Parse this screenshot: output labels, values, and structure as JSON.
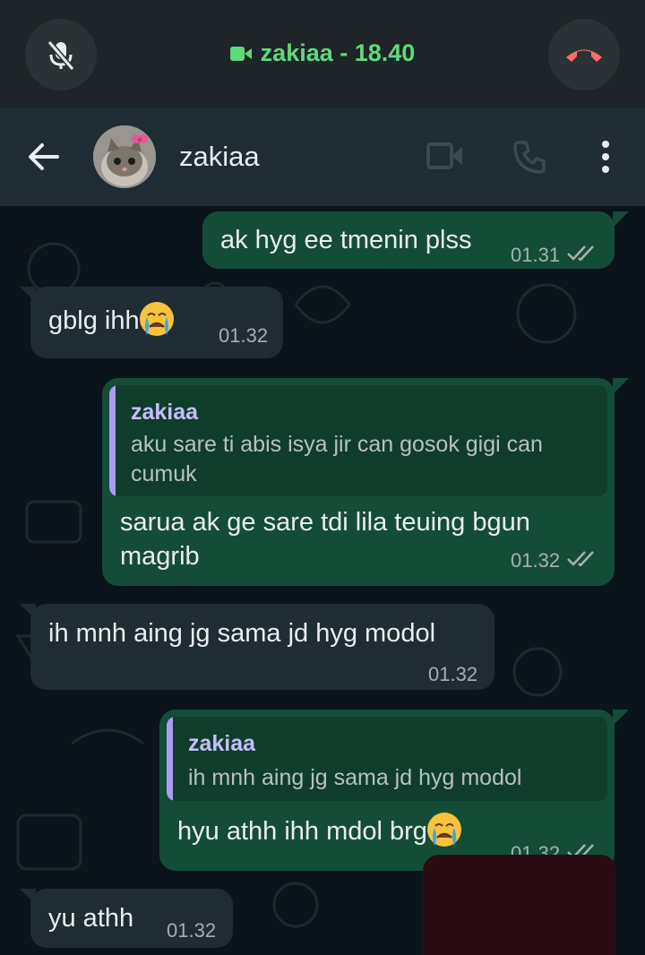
{
  "call_bar": {
    "title": "zakiaa - 18.40"
  },
  "header": {
    "contact_name": "zakiaa"
  },
  "colors": {
    "call_accent": "#5fd97a",
    "end_call": "#ff6b6b",
    "outgoing_bubble": "#144d37",
    "incoming_bubble": "#202c33",
    "quote_bar": "#a99cf2"
  },
  "icons": [
    "mic-off-icon",
    "video-icon",
    "end-call-icon",
    "back-arrow-icon",
    "video-call-icon",
    "voice-call-icon",
    "more-options-icon",
    "read-receipt-icon",
    "crying-emoji-icon"
  ],
  "messages": [
    {
      "direction": "outgoing",
      "text": "ak hyg ee tmenin plss",
      "time": "01.31",
      "status": "read"
    },
    {
      "direction": "incoming",
      "text": "gblg ihh",
      "emoji": "crying-face",
      "time": "01.32"
    },
    {
      "direction": "outgoing",
      "quote": {
        "name": "zakiaa",
        "text": "aku sare ti abis isya jir can gosok gigi can cumuk"
      },
      "text_line1": "sarua ak ge sare tdi lila teuing bgun",
      "text_line2": "magrib",
      "time": "01.32",
      "status": "read"
    },
    {
      "direction": "incoming",
      "text": "ih mnh aing jg sama jd hyg modol",
      "time": "01.32"
    },
    {
      "direction": "outgoing",
      "quote": {
        "name": "zakiaa",
        "text": "ih mnh aing jg sama jd hyg modol"
      },
      "text": "hyu athh ihh mdol brg",
      "emoji": "crying-face",
      "time": "01.32",
      "status": "read"
    },
    {
      "direction": "incoming",
      "text": "yu athh",
      "time": "01.32"
    }
  ]
}
